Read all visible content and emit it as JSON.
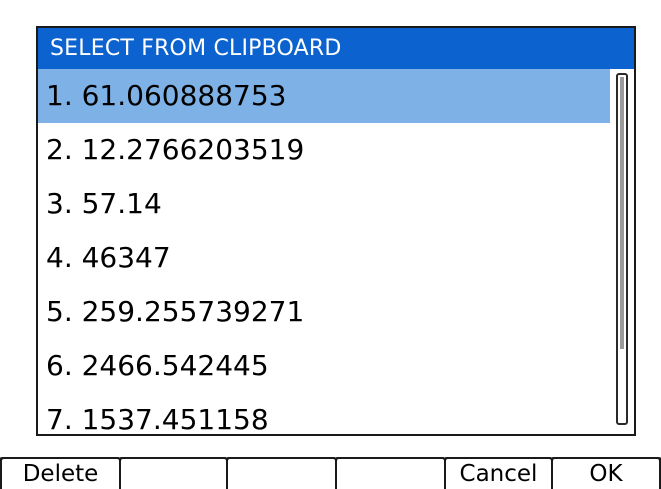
{
  "dialog": {
    "title": "SELECT FROM CLIPBOARD",
    "items": [
      "1. 61.060888753",
      "2. 12.2766203519",
      "3. 57.14",
      "4. 46347",
      "5. 259.255739271",
      "6. 2466.542445",
      "7. 1537.451158"
    ],
    "selected_index": 0
  },
  "softkeys": {
    "delete": "Delete",
    "key2": "",
    "key3": "",
    "key4": "",
    "cancel": "Cancel",
    "ok": "OK"
  },
  "colors": {
    "title_bar": "#0c63d0",
    "selection": "#7eb1e6",
    "softkey_border": "#1a1a1a"
  }
}
